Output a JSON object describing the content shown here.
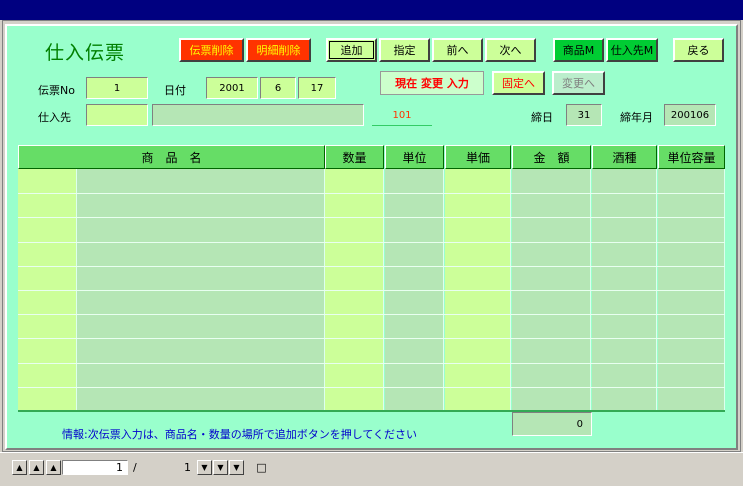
{
  "form": {
    "title": "仕入伝票",
    "buttons": {
      "delete_slip": "伝票削除",
      "delete_detail": "明細削除",
      "add": "追加",
      "specify": "指定",
      "prev": "前へ",
      "next": "次へ",
      "product_master": "商品M",
      "supplier_master": "仕入先M",
      "back": "戻る",
      "fix": "固定へ",
      "change": "変更へ"
    },
    "status": "現在 変更 入力",
    "slip_no": {
      "label": "伝票No",
      "value": "1"
    },
    "date": {
      "label": "日付",
      "year": "2001",
      "month": "6",
      "day": "17"
    },
    "supplier": {
      "label": "仕入先",
      "code": "",
      "name": "",
      "ref_code": "101"
    },
    "closing_day": {
      "label": "締日",
      "value": "31"
    },
    "closing_month": {
      "label": "締年月",
      "value": "200106"
    }
  },
  "grid": {
    "headers": [
      "商　品　名",
      "数量",
      "単位",
      "単価",
      "金　額",
      "酒種",
      "単位容量"
    ],
    "rows": 10
  },
  "footer": {
    "info": "情報:次伝票入力は、商品名・数量の場所で追加ボタンを押してください",
    "total": "0"
  },
  "navigator": {
    "current": "1",
    "separator": "/",
    "total": "1"
  }
}
